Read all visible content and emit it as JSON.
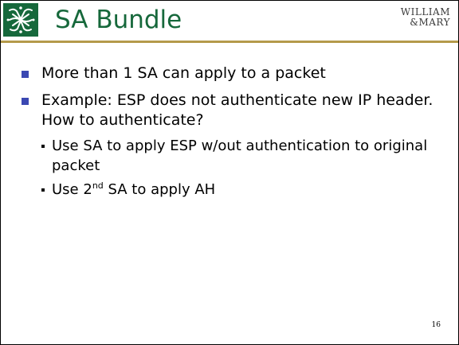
{
  "header": {
    "title": "SA Bundle",
    "logo_icon": "cypher-crest-icon",
    "wordmark_line1": "WILLIAM",
    "wordmark_line2": "&MARY"
  },
  "bullets": [
    {
      "text": "More than 1 SA can apply to a packet"
    },
    {
      "text": "Example: ESP does not authenticate new IP header. How to authenticate?"
    }
  ],
  "sub_bullets": [
    {
      "text": "Use SA to apply ESP w/out authentication to original packet"
    },
    {
      "pre": "Use 2",
      "sup": "nd",
      "post": " SA to apply AH"
    }
  ],
  "footer": {
    "page_number": "16"
  },
  "colors": {
    "brand_green": "#16683b",
    "gold_rule": "#b49a4a",
    "bullet_blue": "#3b48b2"
  }
}
